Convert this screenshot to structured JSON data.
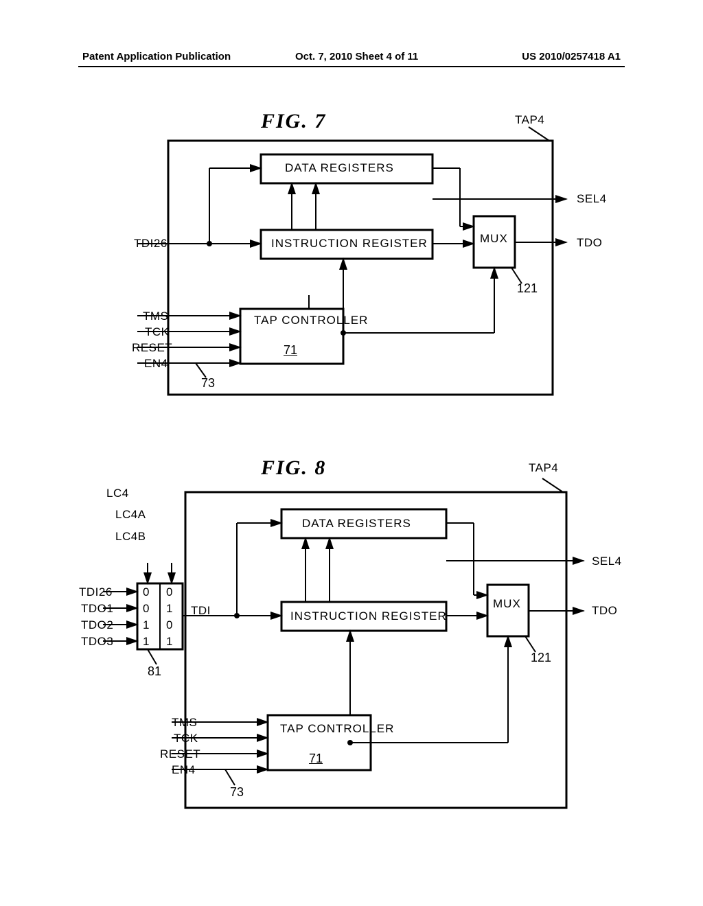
{
  "header": {
    "left": "Patent Application Publication",
    "center": "Oct. 7, 2010   Sheet 4 of 11",
    "right": "US 2010/0257418 A1"
  },
  "fig7": {
    "title": "FIG.  7",
    "module": "TAP4",
    "blocks": {
      "data_registers": "DATA  REGISTERS",
      "instruction_register": "INSTRUCTION  REGISTER",
      "tap_controller": "TAP CONTROLLER",
      "tap_controller_ref": "71",
      "mux": "MUX"
    },
    "signals": {
      "tdi": "TDI26",
      "tms": "TMS",
      "tck": "TCK",
      "reset": "RESET",
      "en": "EN4",
      "sel": "SEL4",
      "tdo": "TDO"
    },
    "refs": {
      "r73": "73",
      "r121": "121"
    }
  },
  "fig8": {
    "title": "FIG.  8",
    "module": "TAP4",
    "lc_labels": {
      "lc4": "LC4",
      "lc4a": "LC4A",
      "lc4b": "LC4B"
    },
    "mux_inputs": {
      "row0": {
        "sig": "TDI26",
        "b1": "0",
        "b0": "0"
      },
      "row1": {
        "sig": "TDO1",
        "b1": "0",
        "b0": "1"
      },
      "row2": {
        "sig": "TDO2",
        "b1": "1",
        "b0": "0"
      },
      "row3": {
        "sig": "TDO3",
        "b1": "1",
        "b0": "1"
      }
    },
    "tdi_label": "TDI",
    "blocks": {
      "data_registers": "DATA  REGISTERS",
      "instruction_register": "INSTRUCTION  REGISTER",
      "tap_controller": "TAP CONTROLLER",
      "tap_controller_ref": "71",
      "mux": "MUX"
    },
    "signals": {
      "tms": "TMS",
      "tck": "TCK",
      "reset": "RESET",
      "en": "EN4",
      "sel": "SEL4",
      "tdo": "TDO"
    },
    "refs": {
      "r81": "81",
      "r73": "73",
      "r121": "121"
    }
  }
}
